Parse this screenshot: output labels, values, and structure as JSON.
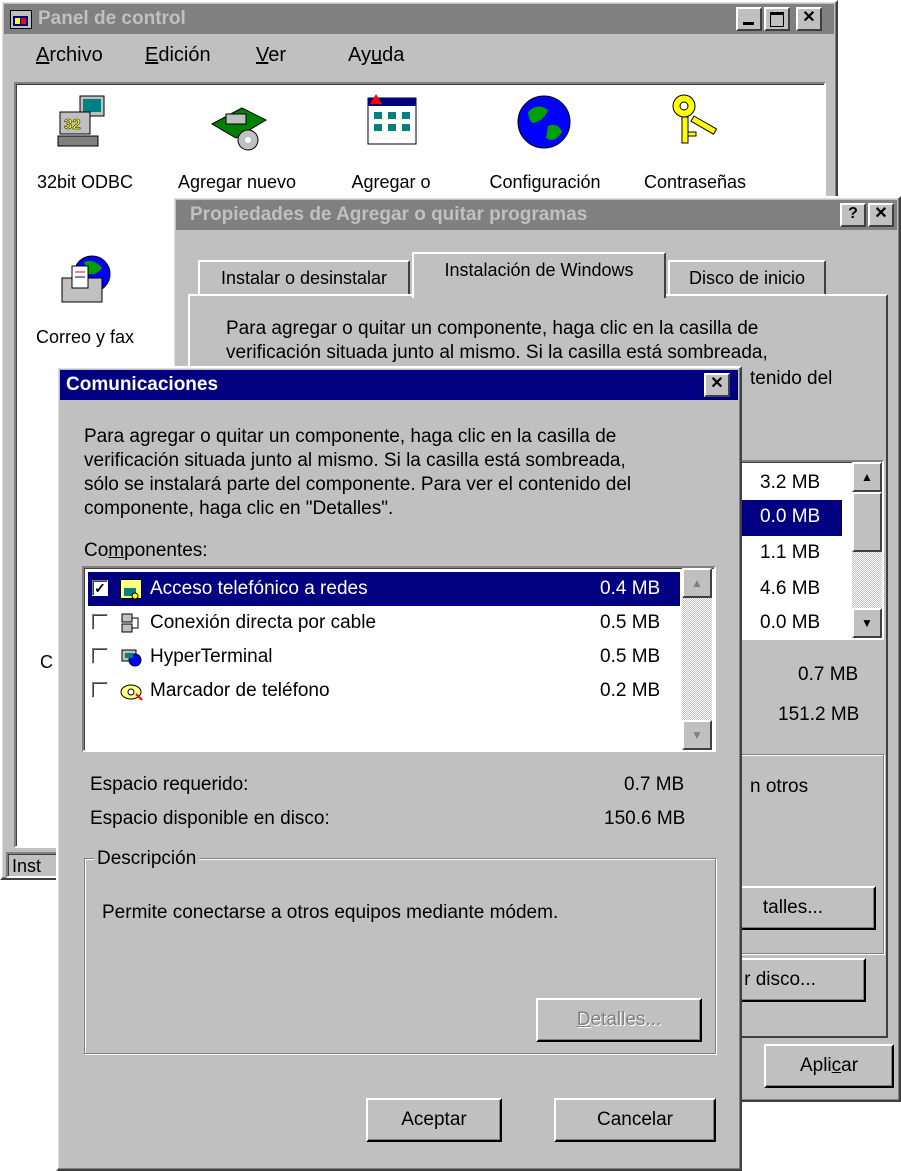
{
  "control_panel": {
    "title": "Panel de control",
    "menu": [
      "Archivo",
      "Edición",
      "Ver",
      "Ayuda"
    ],
    "icons": [
      "32bit ODBC",
      "Agregar nuevo",
      "Agregar o",
      "Configuración",
      "Contraseñas",
      "Correo y fax"
    ],
    "partial_label_c": "C",
    "status_partial": "Inst"
  },
  "properties": {
    "title": "Propiedades de Agregar o quitar programas",
    "tabs": [
      "Instalar o desinstalar",
      "Instalación de Windows",
      "Disco de inicio"
    ],
    "desc_line1": "Para agregar o quitar un componente, haga clic en la casilla de",
    "desc_line2": "verificación situada junto al mismo. Si la casilla está sombreada,",
    "desc_line3_partial": "tenido del",
    "sizes": [
      "3.2 MB",
      "0.0 MB",
      "1.1 MB",
      "4.6 MB",
      "0.0 MB"
    ],
    "required": "0.7 MB",
    "available": "151.2 MB",
    "desc_partial": "n otros",
    "details_partial": "talles...",
    "disk_partial": "r disco...",
    "apply": "Aplicar"
  },
  "dialog": {
    "title": "Comunicaciones",
    "instructions": [
      "Para agregar o quitar un componente, haga clic en la casilla de",
      "verificación situada junto al mismo. Si la casilla está sombreada,",
      "sólo se instalará parte del componente. Para ver el contenido del",
      "componente, haga clic en \"Detalles\"."
    ],
    "components_label": "Componentes:",
    "components": [
      {
        "name": "Acceso telefónico a redes",
        "size": "0.4 MB",
        "checked": true,
        "icon": "dialup-network-icon"
      },
      {
        "name": "Conexión directa por cable",
        "size": "0.5 MB",
        "checked": false,
        "icon": "direct-cable-icon"
      },
      {
        "name": "HyperTerminal",
        "size": "0.5 MB",
        "checked": false,
        "icon": "hyperterminal-icon"
      },
      {
        "name": "Marcador de teléfono",
        "size": "0.2 MB",
        "checked": false,
        "icon": "phone-dialer-icon"
      }
    ],
    "space_required_label": "Espacio requerido:",
    "space_required": "0.7 MB",
    "space_available_label": "Espacio disponible en disco:",
    "space_available": "150.6 MB",
    "description_group": "Descripción",
    "description_text": "Permite conectarse a otros equipos mediante módem.",
    "details_button": "Detalles...",
    "ok_button": "Aceptar",
    "cancel_button": "Cancelar"
  },
  "colors": {
    "face": "#c0c0c0",
    "active_title": "#000080",
    "inactive_title": "#808080"
  }
}
